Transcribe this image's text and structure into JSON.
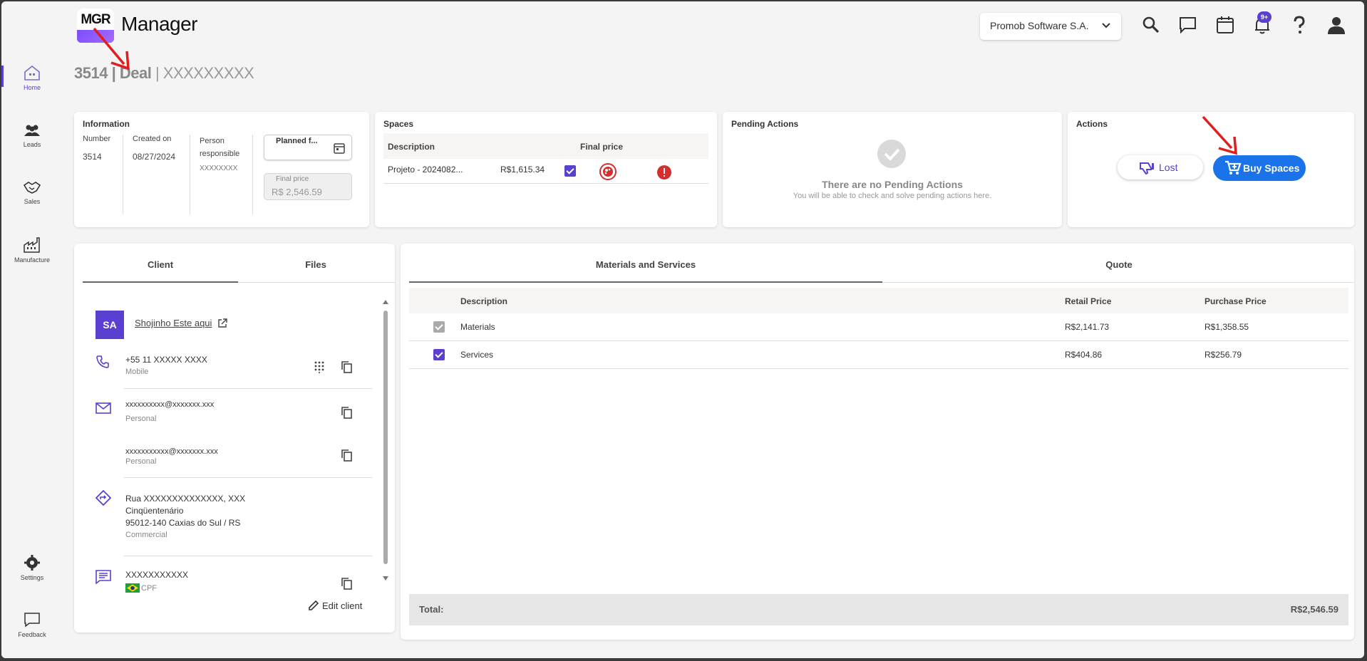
{
  "header": {
    "logo_text": "MGR",
    "app_title": "Manager",
    "company": "Promob Software S.A.",
    "notification_badge": "9+"
  },
  "page": {
    "number": "3514",
    "type": "Deal",
    "name": "XXXXXXXXX",
    "sep": " | "
  },
  "sidebar": {
    "items": [
      {
        "label": "Home",
        "icon": "home-icon"
      },
      {
        "label": "Leads",
        "icon": "people-icon"
      },
      {
        "label": "Sales",
        "icon": "handshake-icon"
      },
      {
        "label": "Manufacture",
        "icon": "factory-icon"
      },
      {
        "label": "Settings",
        "icon": "gear-icon"
      },
      {
        "label": "Feedback",
        "icon": "feedback-icon"
      }
    ]
  },
  "information": {
    "title": "Information",
    "number_label": "Number",
    "number": "3514",
    "created_label": "Created on",
    "created": "08/27/2024",
    "person_label": "Person responsible",
    "person": "XXXXXXXX",
    "planned_label": "Planned f...",
    "final_price_label": "Final price",
    "final_price": "R$ 2,546.59"
  },
  "spaces": {
    "title": "Spaces",
    "col_description": "Description",
    "col_final_price": "Final price",
    "rows": [
      {
        "description": "Projeto - 2024082...",
        "price": "R$1,615.34"
      }
    ]
  },
  "pending": {
    "title": "Pending Actions",
    "empty_title": "There are no Pending Actions",
    "empty_sub": "You will be able to check and solve pending actions here."
  },
  "actions": {
    "title": "Actions",
    "lost_label": "Lost",
    "buy_label": "Buy Spaces"
  },
  "client_tabs": {
    "client": "Client",
    "files": "Files"
  },
  "client": {
    "initials": "SA",
    "name": "Shojinho Este aqui",
    "phone": "+55 11  XXXXX XXXX",
    "phone_type": "Mobile",
    "email1": "xxxxxxxxxx@xxxxxxx.xxx",
    "email1_type": "Personal",
    "email2": "xxxxxxxxxxx@xxxxxxx.xxx",
    "email2_type": "Personal",
    "address_line1": "Rua XXXXXXXXXXXXXX, XXX",
    "address_line2": "Cinqüentenário",
    "address_line3": "95012-140 Caxias do Sul / RS",
    "address_type": "Commercial",
    "document": "XXXXXXXXXXX",
    "document_type": "CPF",
    "edit_label": "Edit client"
  },
  "materials_tabs": {
    "materials": "Materials and Services",
    "quote": "Quote"
  },
  "materials": {
    "col_description": "Description",
    "col_retail": "Retail Price",
    "col_purchase": "Purchase Price",
    "rows": [
      {
        "description": "Materials",
        "retail": "R$2,141.73",
        "purchase": "R$1,358.55"
      },
      {
        "description": "Services",
        "retail": "R$404.86",
        "purchase": "R$256.79"
      }
    ],
    "total_label": "Total:",
    "total_value": "R$2,546.59"
  },
  "colors": {
    "accent": "#5b3fd1",
    "primary_button": "#1a73e8",
    "annotation_arrow": "#e11d1d"
  }
}
